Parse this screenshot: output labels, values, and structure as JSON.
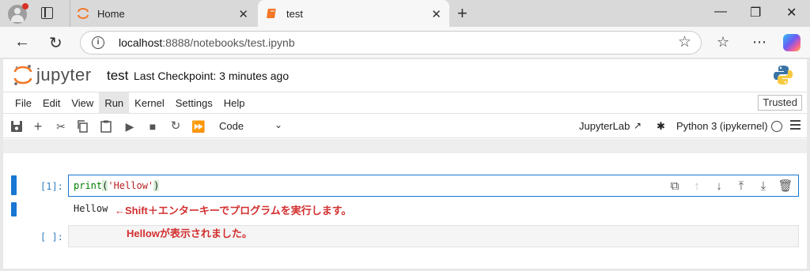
{
  "browser": {
    "tabs": [
      {
        "title": "Home"
      },
      {
        "title": "test"
      }
    ],
    "url_host": "localhost",
    "url_path": ":8888/notebooks/test.ipynb"
  },
  "jupyter": {
    "brand": "jupyter",
    "notebook_name": "test",
    "checkpoint": "Last Checkpoint: 3 minutes ago",
    "menu": [
      "File",
      "Edit",
      "View",
      "Run",
      "Kernel",
      "Settings",
      "Help"
    ],
    "menu_selected": "Run",
    "trusted": "Trusted",
    "cell_type": "Code",
    "jupyterlab_link": "JupyterLab",
    "kernel_name": "Python 3 (ipykernel)"
  },
  "cells": {
    "cell1_prompt": "[1]:",
    "cell1_code_fn": "print",
    "cell1_code_open": "(",
    "cell1_code_str": "'Hellow'",
    "cell1_code_close": ")",
    "cell1_output": "Hellow",
    "cell2_prompt": "[ ]:"
  },
  "annotations": {
    "line1": "←Shift＋エンターキーでプログラムを実行します。",
    "line2": "Hellowが表示されました。"
  },
  "colors": {
    "accent": "#1976d2",
    "annotation": "#d32f2f",
    "prompt": "#307fc1"
  }
}
